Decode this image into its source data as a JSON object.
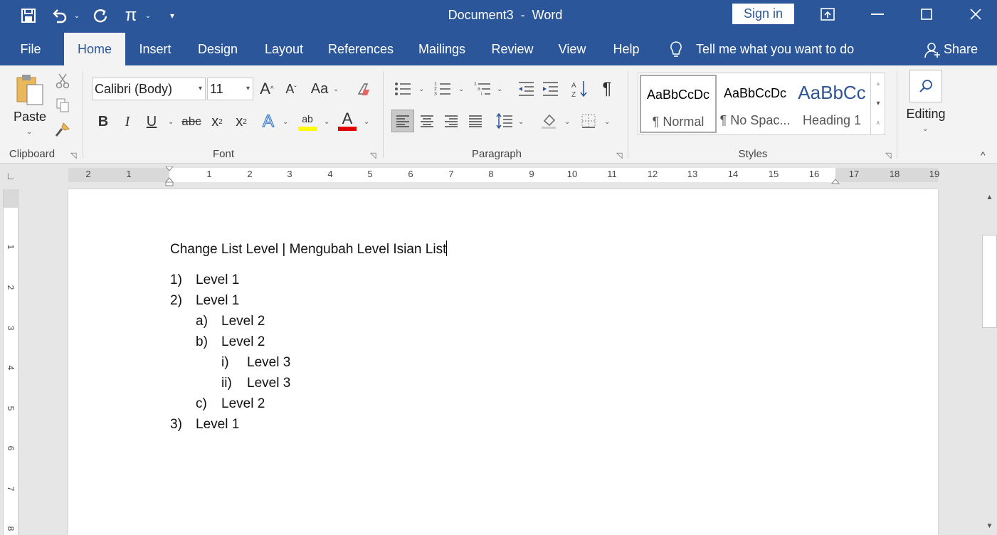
{
  "window": {
    "doc_title": "Document3  -  Word",
    "sign_in": "Sign in",
    "quick_access": [
      "save-icon",
      "undo-icon",
      "redo-icon",
      "equation-icon",
      "customize-icon"
    ],
    "equation_symbol": "π"
  },
  "tabs": [
    "File",
    "Home",
    "Insert",
    "Design",
    "Layout",
    "References",
    "Mailings",
    "Review",
    "View",
    "Help"
  ],
  "active_tab": "Home",
  "tell_me": "Tell me what you want to do",
  "share": "Share",
  "ribbon": {
    "clipboard": {
      "label": "Clipboard",
      "paste": "Paste"
    },
    "font": {
      "label": "Font",
      "family": "Calibri (Body)",
      "size": "11",
      "case": "Aa",
      "bold": "B",
      "italic": "I",
      "underline": "U",
      "strike": "abc",
      "sub": "x",
      "sub_mark": "2",
      "sup": "x",
      "sup_mark": "2",
      "text_effect": "A",
      "highlight": "ab",
      "font_color": "A",
      "grow": "A",
      "shrink": "A"
    },
    "paragraph": {
      "label": "Paragraph",
      "pilcrow": "¶"
    },
    "styles": {
      "label": "Styles",
      "items": [
        {
          "sample": "AaBbCcDc",
          "name": "¶ Normal"
        },
        {
          "sample": "AaBbCcDc",
          "name": "¶ No Spac..."
        },
        {
          "sample": "AaBbCc",
          "name": "Heading 1"
        }
      ]
    },
    "editing": {
      "label": "Editing"
    }
  },
  "ruler": {
    "h_left_numbers": [
      "2",
      "1"
    ],
    "h_numbers": [
      "1",
      "2",
      "3",
      "4",
      "5",
      "6",
      "7",
      "8",
      "9",
      "10",
      "11",
      "12",
      "13",
      "14",
      "15",
      "16"
    ],
    "h_right_numbers": [
      "17",
      "18",
      "19"
    ],
    "v_numbers": [
      "1",
      "2",
      "3",
      "4",
      "5",
      "6",
      "7",
      "8"
    ]
  },
  "document": {
    "title": "Change List Level | Mengubah Level Isian List",
    "list": [
      {
        "marker": "1)",
        "text": "Level 1",
        "level": 1
      },
      {
        "marker": "2)",
        "text": "Level 1",
        "level": 1
      },
      {
        "marker": "a)",
        "text": "Level 2",
        "level": 2
      },
      {
        "marker": "b)",
        "text": "Level 2",
        "level": 2
      },
      {
        "marker": "i)",
        "text": "Level 3",
        "level": 3
      },
      {
        "marker": "ii)",
        "text": "Level 3",
        "level": 3
      },
      {
        "marker": "c)",
        "text": "Level 2",
        "level": 2
      },
      {
        "marker": "3)",
        "text": "Level 1",
        "level": 1
      }
    ]
  },
  "colors": {
    "accent": "#2b579a",
    "highlight": "#ffff00",
    "font_color": "#e00000"
  }
}
